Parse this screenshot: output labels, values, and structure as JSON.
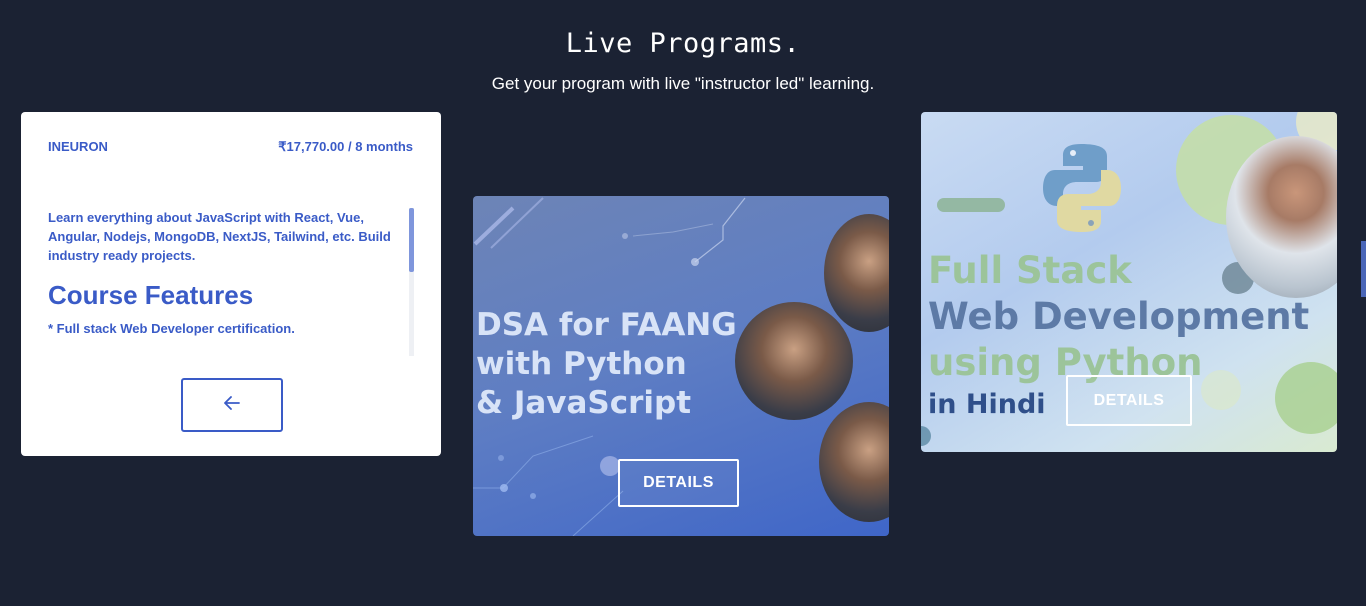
{
  "header": {
    "title": "Live Programs.",
    "subtitle": "Get your program with live \"instructor led\" learning."
  },
  "card_back": {
    "provider": "INEURON",
    "price": "₹17,770.00 / 8 months",
    "description": "Learn everything about JavaScript with React, Vue, Angular, Nodejs, MongoDB, NextJS, Tailwind, etc. Build industry ready projects.",
    "features_title": "Course Features",
    "features": [
      "* Full stack Web Developer certification."
    ],
    "back_icon": "arrow-left-icon"
  },
  "card_dsa": {
    "banner_lines": [
      "DSA for FAANG",
      "with Python",
      "& JavaScript"
    ],
    "details_label": "DETAILS"
  },
  "card_fullstack": {
    "banner_lines": [
      "Full Stack",
      "Web Development",
      "using Python",
      "in Hindi"
    ],
    "details_label": "DETAILS"
  },
  "colors": {
    "background": "#1b2233",
    "accent": "#3a5bc7"
  }
}
